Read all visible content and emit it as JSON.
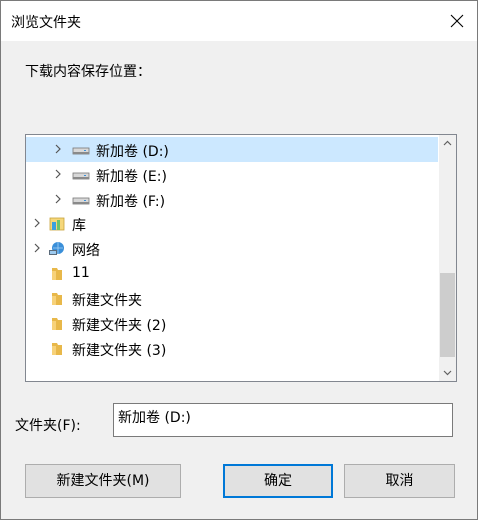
{
  "window": {
    "title": "浏览文件夹"
  },
  "prompt": "下载内容保存位置：",
  "tree": {
    "items": [
      {
        "label": "新加卷 (D:)",
        "icon": "drive-icon",
        "expandable": true,
        "selected": true
      },
      {
        "label": "新加卷 (E:)",
        "icon": "drive-icon",
        "expandable": true,
        "selected": false
      },
      {
        "label": "新加卷 (F:)",
        "icon": "drive-icon",
        "expandable": true,
        "selected": false
      },
      {
        "label": "库",
        "icon": "library-icon",
        "expandable": true,
        "selected": false
      },
      {
        "label": "网络",
        "icon": "network-icon",
        "expandable": true,
        "selected": false
      },
      {
        "label": "11",
        "icon": "folder-icon",
        "expandable": false,
        "selected": false
      },
      {
        "label": "新建文件夹",
        "icon": "folder-icon",
        "expandable": false,
        "selected": false
      },
      {
        "label": "新建文件夹 (2)",
        "icon": "folder-icon",
        "expandable": false,
        "selected": false
      },
      {
        "label": "新建文件夹 (3)",
        "icon": "folder-icon",
        "expandable": false,
        "selected": false
      }
    ]
  },
  "folder_field": {
    "label": "文件夹(F):",
    "value": "新加卷 (D:)"
  },
  "buttons": {
    "new_folder": "新建文件夹(M)",
    "ok": "确定",
    "cancel": "取消"
  },
  "colors": {
    "selection": "#cce8ff",
    "default_button_border": "#0078d7",
    "folder": "#e8b84a"
  }
}
